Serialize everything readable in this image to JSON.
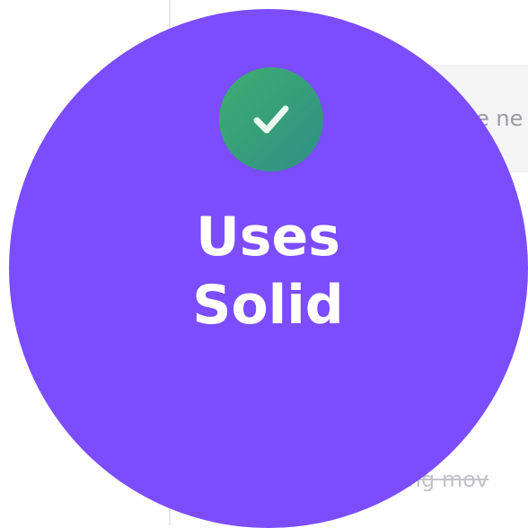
{
  "background": {
    "input_placeholder_fragment": "e ne",
    "todo_item_fragment": "cking mov"
  },
  "badge": {
    "icon": "check-icon",
    "title_line1": "Uses",
    "title_line2": "Solid",
    "color": "#7b4dff",
    "icon_gradient": [
      "#3fae6f",
      "#2f8e86"
    ],
    "text_color": "#ffffff"
  }
}
